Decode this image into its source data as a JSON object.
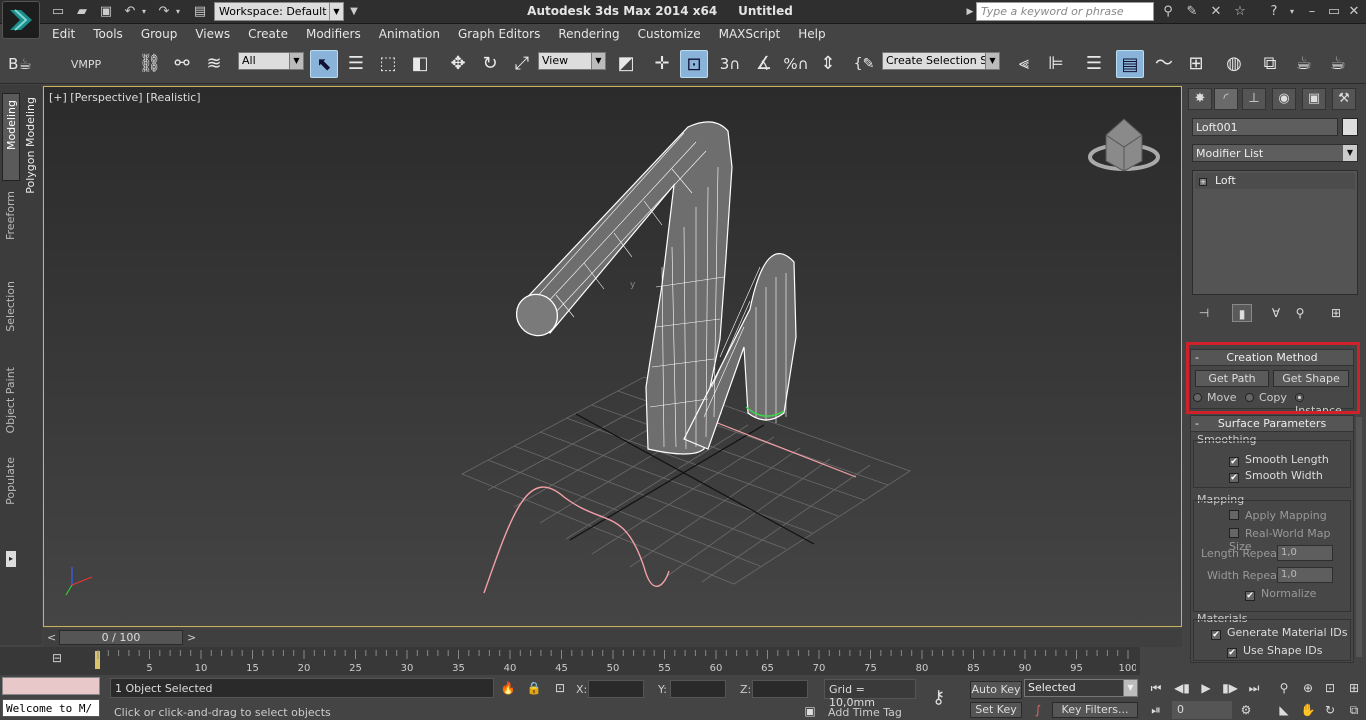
{
  "titlebar": {
    "app_title": "Autodesk 3ds Max  2014 x64",
    "doc_title": "Untitled",
    "workspace_label": "Workspace: Default",
    "search_placeholder": "Type a keyword or phrase"
  },
  "menus": [
    "Edit",
    "Tools",
    "Group",
    "Views",
    "Create",
    "Modifiers",
    "Animation",
    "Graph Editors",
    "Rendering",
    "Customize",
    "MAXScript",
    "Help"
  ],
  "toolbar": {
    "vmpp_label": "VMPP",
    "filter_value": "All",
    "refcoord_value": "View",
    "named_selection_value": "Create Selection Se"
  },
  "left_tabs": [
    "Modeling",
    "Freeform",
    "Selection",
    "Object Paint",
    "Populate"
  ],
  "ribbon_tab": "Polygon Modeling",
  "viewport": {
    "label": "[+] [Perspective] [Realistic]"
  },
  "command_panel": {
    "object_name": "Loft001",
    "modifier_list_label": "Modifier List",
    "stack_item": "Loft",
    "creation_method": {
      "title": "Creation Method",
      "get_path": "Get Path",
      "get_shape": "Get Shape",
      "options": [
        "Move",
        "Copy",
        "Instance"
      ],
      "selected": "Instance"
    },
    "surface_params": {
      "title": "Surface Parameters",
      "smoothing_label": "Smoothing",
      "smooth_length": "Smooth Length",
      "smooth_width": "Smooth Width",
      "mapping_label": "Mapping",
      "apply_mapping": "Apply Mapping",
      "real_world": "Real-World Map Size",
      "length_repeat_label": "Length Repeat:",
      "length_repeat_value": "1,0",
      "width_repeat_label": "Width Repeat:",
      "width_repeat_value": "1,0",
      "normalize": "Normalize",
      "materials_label": "Materials",
      "gen_mat_ids": "Generate Material IDs",
      "use_shape_ids": "Use Shape IDs"
    },
    "highlight_color": "#d0202a"
  },
  "timeline": {
    "frame_display": "0 / 100",
    "ticks": [
      "0",
      "5",
      "10",
      "15",
      "20",
      "25",
      "30",
      "35",
      "40",
      "45",
      "50",
      "55",
      "60",
      "65",
      "70",
      "75",
      "80",
      "85",
      "90",
      "95",
      "100"
    ]
  },
  "status": {
    "script_text": "Welcome to M/",
    "selection_count": "1 Object Selected",
    "prompt": "Click or click-and-drag to select objects",
    "x_label": "X:",
    "y_label": "Y:",
    "z_label": "Z:",
    "grid": "Grid = 10,0mm",
    "add_time_tag": "Add Time Tag",
    "auto_key": "Auto Key",
    "set_key": "Set Key",
    "key_mode_value": "Selected",
    "key_filters": "Key Filters...",
    "frame_spinner": "0"
  }
}
